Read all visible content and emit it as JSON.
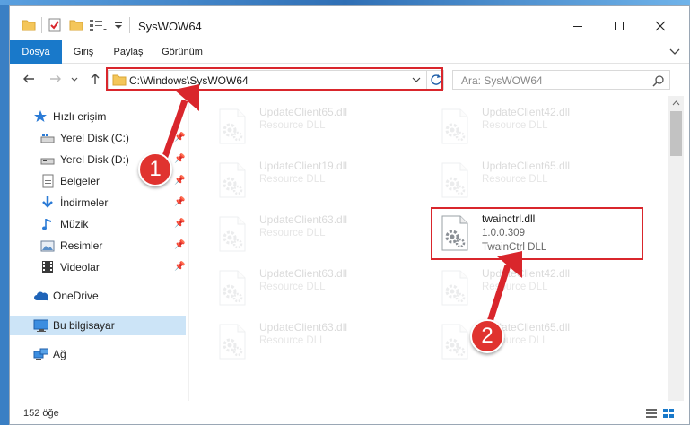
{
  "window": {
    "title": "SysWOW64"
  },
  "ribbon": {
    "tabs": [
      {
        "label": "Dosya",
        "active": true
      },
      {
        "label": "Giriş",
        "active": false
      },
      {
        "label": "Paylaş",
        "active": false
      },
      {
        "label": "Görünüm",
        "active": false
      }
    ]
  },
  "address": {
    "path": "C:\\Windows\\SysWOW64"
  },
  "search": {
    "placeholder": "Ara: SysWOW64"
  },
  "sidebar": {
    "items": [
      {
        "label": "Hızlı erişim",
        "icon": "star-icon"
      },
      {
        "label": "Yerel Disk (C:)",
        "icon": "drive-icon",
        "pinned": true
      },
      {
        "label": "Yerel Disk (D:)",
        "icon": "drive-icon",
        "pinned": true
      },
      {
        "label": "Belgeler",
        "icon": "documents-icon",
        "pinned": true
      },
      {
        "label": "İndirmeler",
        "icon": "download-icon",
        "pinned": true
      },
      {
        "label": "Müzik",
        "icon": "music-icon",
        "pinned": true
      },
      {
        "label": "Resimler",
        "icon": "pictures-icon",
        "pinned": true
      },
      {
        "label": "Videolar",
        "icon": "video-icon",
        "pinned": true
      },
      {
        "label": "OneDrive",
        "icon": "cloud-icon"
      },
      {
        "label": "Bu bilgisayar",
        "icon": "computer-icon",
        "selected": true
      },
      {
        "label": "Ağ",
        "icon": "network-icon"
      }
    ]
  },
  "files": {
    "faded": [
      {
        "name": "UpdateClient65.dll",
        "desc": "Resource DLL"
      },
      {
        "name": "UpdateClient42.dll",
        "desc": "Resource DLL"
      },
      {
        "name": "UpdateClient19.dll",
        "desc": "Resource DLL"
      },
      {
        "name": "UpdateClient65.dll",
        "desc": "Resource DLL"
      },
      {
        "name": "UpdateClient63.dll",
        "desc": "Resource DLL"
      },
      {
        "name": "UpdateClient63.dll",
        "desc": "Resource DLL"
      },
      {
        "name": "UpdateClient42.dll",
        "desc": "Resource DLL"
      },
      {
        "name": "UpdateClient63.dll",
        "desc": "Resource DLL"
      },
      {
        "name": "UpdateClient65.dll",
        "desc": "Resource DLL"
      }
    ],
    "highlighted": {
      "name": "twainctrl.dll",
      "version": "1.0.0.309",
      "desc": "TwainCtrl DLL"
    }
  },
  "status": {
    "count": "152 öğe"
  },
  "annotations": {
    "step1": "1",
    "step2": "2",
    "color": "#d9262c"
  }
}
